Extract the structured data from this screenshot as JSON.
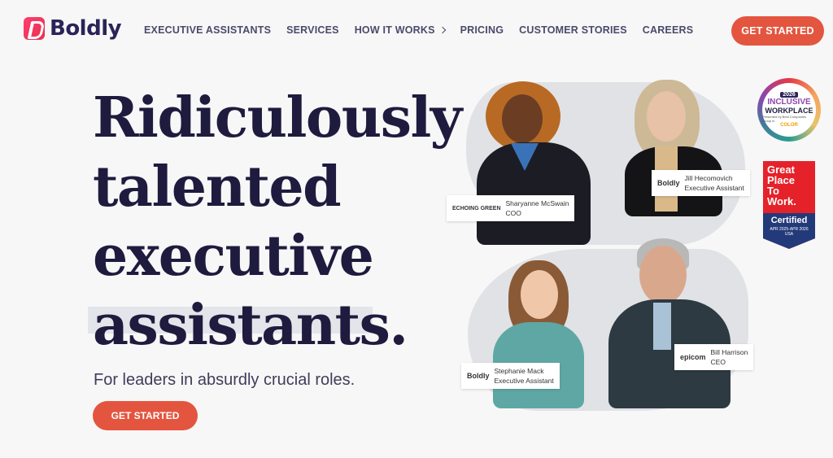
{
  "brand": {
    "name": "Boldly",
    "logo_icon": "boldly-logo-icon"
  },
  "nav": {
    "items": [
      {
        "label": "EXECUTIVE ASSISTANTS",
        "has_dropdown": false
      },
      {
        "label": "SERVICES",
        "has_dropdown": false
      },
      {
        "label": "HOW IT WORKS",
        "has_dropdown": true
      },
      {
        "label": "PRICING",
        "has_dropdown": false
      },
      {
        "label": "CUSTOMER STORIES",
        "has_dropdown": false
      },
      {
        "label": "CAREERS",
        "has_dropdown": false
      }
    ],
    "cta_label": "GET STARTED"
  },
  "hero": {
    "title_lines": [
      "Ridiculously",
      "talented",
      "executive",
      "assistants."
    ],
    "subtitle": "For leaders in absurdly crucial roles.",
    "cta_label": "GET STARTED"
  },
  "people": [
    {
      "company": "ECHOING GREEN",
      "name": "Sharyanne McSwain",
      "role": "COO"
    },
    {
      "company": "Boldly",
      "name": "Jill Hecomovich",
      "role": "Executive Assistant"
    },
    {
      "company": "Boldly",
      "name": "Stephanie Mack",
      "role": "Executive Assistant"
    },
    {
      "company": "epicom",
      "name": "Bill Harrison",
      "role": "CEO"
    }
  ],
  "badges": {
    "inclusive": {
      "year": "2026",
      "word1": "INCLUSIVE",
      "word2": "WORKPLACE",
      "by": "Presented by Best Companies Group in",
      "color": "COLOR"
    },
    "gptw": {
      "title_lines": [
        "Great",
        "Place",
        "To",
        "Work."
      ],
      "certified": "Certified",
      "dates": "APR 2025-APR 2026",
      "country": "USA"
    }
  },
  "colors": {
    "accent": "#e4553f",
    "brand_dark": "#1e1b3e",
    "background": "#f7f7f7"
  }
}
